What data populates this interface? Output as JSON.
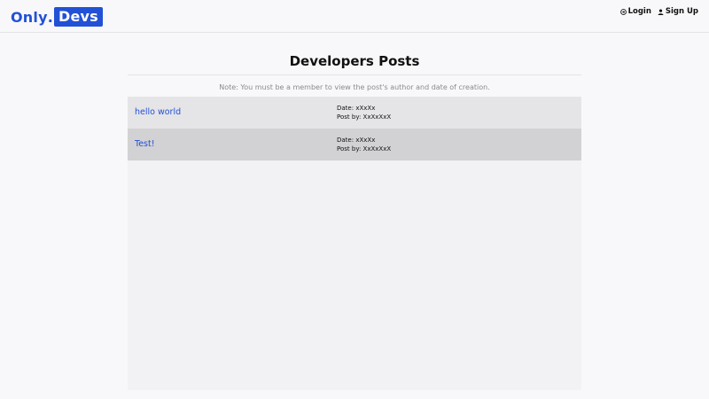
{
  "header": {
    "logo_part1": "Only",
    "logo_dot": ".",
    "logo_part2": "Devs",
    "nav": [
      {
        "label": "Login",
        "icon": "login-icon"
      },
      {
        "label": "Sign Up",
        "icon": "user-icon"
      }
    ]
  },
  "main": {
    "title": "Developers Posts",
    "note": "Note: You must be a member to view the post's author and date of creation.",
    "posts": [
      {
        "title": "hello world",
        "date_label": "Date: xXxXx",
        "author_label": "Post by: XxXxXxX"
      },
      {
        "title": "Test!",
        "date_label": "Date: xXxXx",
        "author_label": "Post by: XxXxXxX"
      }
    ]
  },
  "colors": {
    "accent": "#2251d6",
    "background": "#f8f7f9",
    "row_light": "#e5e4e7",
    "row_dark": "#d2d1d4"
  }
}
